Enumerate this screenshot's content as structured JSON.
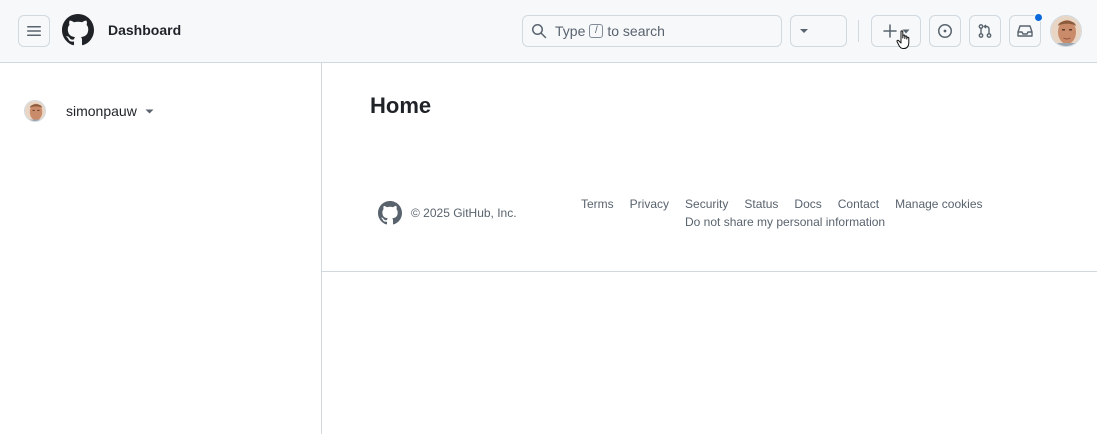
{
  "header": {
    "context_title": "Dashboard",
    "search": {
      "prefix": "Type",
      "shortcut": "/",
      "suffix": "to search"
    },
    "notification_dot_color": "#0969da",
    "icons": [
      "menu-icon",
      "github-logo",
      "search-icon",
      "copilot-icon",
      "triangle-down-icon",
      "plus-icon",
      "issue-opened-icon",
      "git-pull-request-icon",
      "inbox-icon",
      "avatar"
    ]
  },
  "sidebar": {
    "user": {
      "name": "simonpauw"
    }
  },
  "main": {
    "title": "Home"
  },
  "footer": {
    "copyright": "© 2025 GitHub, Inc.",
    "links": [
      "Terms",
      "Privacy",
      "Security",
      "Status",
      "Docs",
      "Contact",
      "Manage cookies"
    ],
    "extra": "Do not share my personal information"
  }
}
